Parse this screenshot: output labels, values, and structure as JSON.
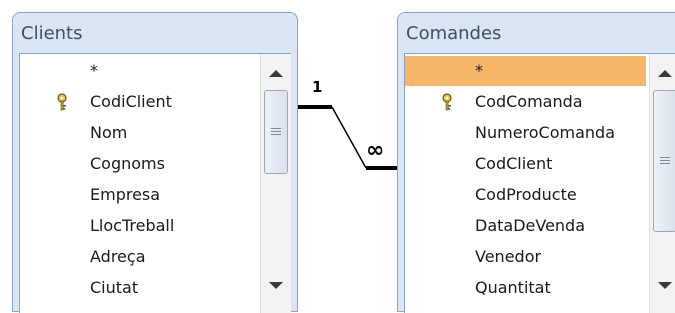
{
  "tables": {
    "clients": {
      "title": "Clients",
      "fields": [
        "*",
        "CodiClient",
        "Nom",
        "Cognoms",
        "Empresa",
        "LlocTreball",
        "Adreça",
        "Ciutat"
      ],
      "key_field_index": 1
    },
    "comandes": {
      "title": "Comandes",
      "fields": [
        "*",
        "CodComanda",
        "NumeroComanda",
        "CodClient",
        "CodProducte",
        "DataDeVenda",
        "Venedor",
        "Quantitat"
      ],
      "key_field_index": 1,
      "selected_field_index": 0
    }
  },
  "relationship": {
    "one_label": "1",
    "many_label": "∞"
  },
  "colors": {
    "header_bg": "#dbe6f4",
    "selection": "#f7b56a",
    "border": "#8aa3c4"
  }
}
